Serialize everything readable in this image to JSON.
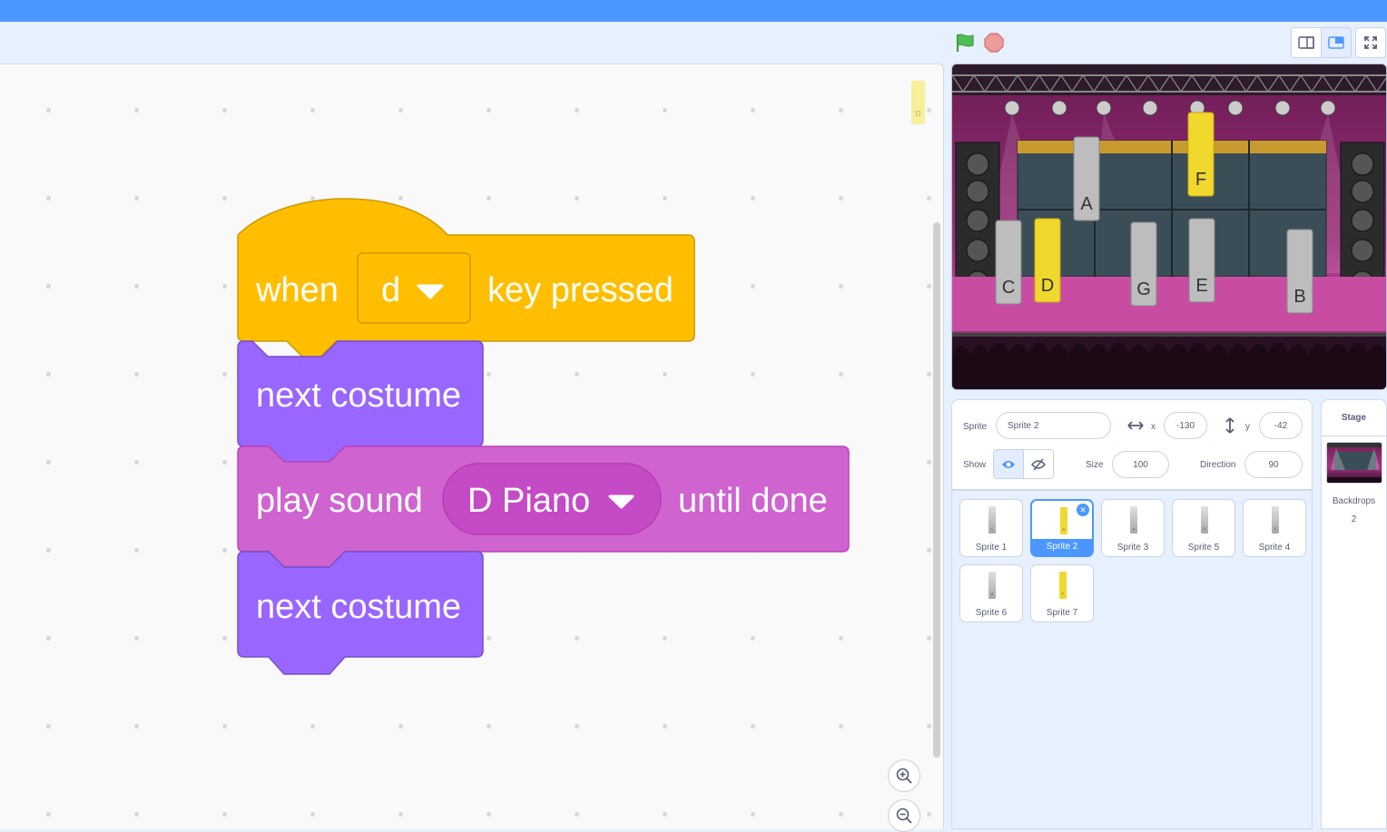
{
  "colors": {
    "menu_bar": "#4c97ff",
    "events_block": "#ffbf00",
    "looks_block": "#9966ff",
    "sound_block": "#cf63cf",
    "selected_accent": "#4c97ff",
    "green_flag": "#4cbf56",
    "stop": "#ec9a9a"
  },
  "controls": {
    "green_flag_icon": "green-flag-icon",
    "stop_icon": "stop-sign-icon",
    "small_stage_icon": "small-stage-icon",
    "normal_stage_icon": "normal-stage-icon",
    "fullscreen_icon": "fullscreen-icon"
  },
  "code": {
    "minimap_label": "D",
    "blocks": [
      {
        "category": "events",
        "parts": {
          "when": "when",
          "key": "d",
          "rest": "key pressed"
        }
      },
      {
        "category": "looks",
        "text": "next costume"
      },
      {
        "category": "sound",
        "parts": {
          "play": "play sound",
          "sound": "D Piano",
          "rest": "until done"
        }
      },
      {
        "category": "looks",
        "text": "next costume"
      }
    ],
    "zoom_in_icon": "zoom-in-icon",
    "zoom_out_icon": "zoom-out-icon"
  },
  "stage": {
    "keys": [
      {
        "note": "C",
        "color": "grey"
      },
      {
        "note": "D",
        "color": "yellow"
      },
      {
        "note": "A",
        "color": "grey"
      },
      {
        "note": "G",
        "color": "grey"
      },
      {
        "note": "F",
        "color": "yellow"
      },
      {
        "note": "E",
        "color": "grey"
      },
      {
        "note": "B",
        "color": "grey"
      }
    ]
  },
  "sprite_info": {
    "sprite_label": "Sprite",
    "sprite_name": "Sprite 2",
    "x_label": "x",
    "x_value": "-130",
    "y_label": "y",
    "y_value": "-42",
    "show_label": "Show",
    "size_label": "Size",
    "size_value": "100",
    "direction_label": "Direction",
    "direction_value": "90"
  },
  "sprites": [
    {
      "name": "Sprite 1",
      "letter": "C",
      "color": "grey",
      "selected": false
    },
    {
      "name": "Sprite 2",
      "letter": "D",
      "color": "yellow",
      "selected": true
    },
    {
      "name": "Sprite 3",
      "letter": "A",
      "color": "grey",
      "selected": false
    },
    {
      "name": "Sprite 5",
      "letter": "G",
      "color": "grey",
      "selected": false
    },
    {
      "name": "Sprite 4",
      "letter": "E",
      "color": "grey",
      "selected": false
    },
    {
      "name": "Sprite 6",
      "letter": "B",
      "color": "grey",
      "selected": false
    },
    {
      "name": "Sprite 7",
      "letter": "F",
      "color": "yellow",
      "selected": false
    }
  ],
  "stage_pane": {
    "title": "Stage",
    "backdrops_label": "Backdrops",
    "backdrops_count": "2"
  }
}
